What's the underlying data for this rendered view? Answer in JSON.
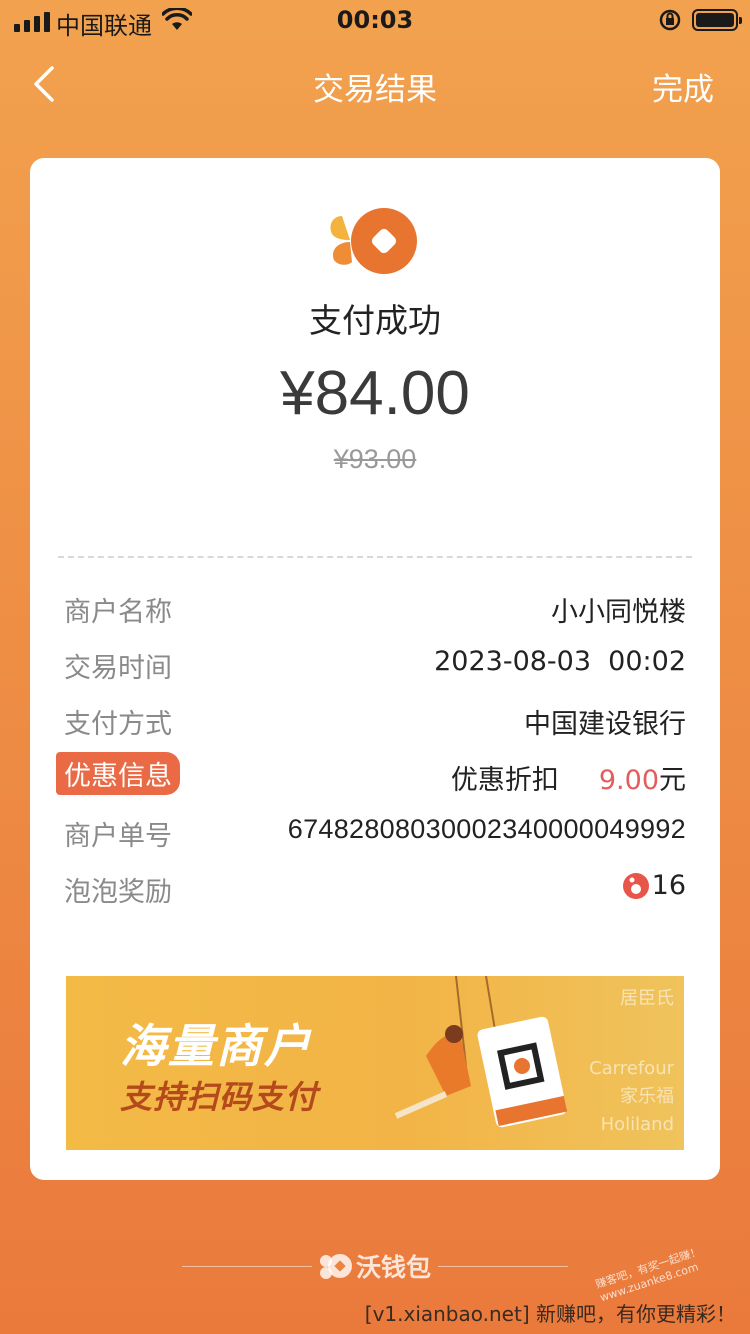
{
  "status_bar": {
    "carrier": "中国联通",
    "time": "00:03"
  },
  "nav": {
    "title": "交易结果",
    "done_label": "完成"
  },
  "result": {
    "status": "支付成功",
    "amount": "¥84.00",
    "original_amount": "¥93.00"
  },
  "details": {
    "merchant_label": "商户名称",
    "merchant_value": "小小同悦楼",
    "time_label": "交易时间",
    "time_value": "2023-08-03  00:02",
    "method_label": "支付方式",
    "method_value": "中国建设银行",
    "promo_label": "优惠信息",
    "promo_type": "优惠折扣",
    "promo_amount": "9.00",
    "promo_unit": "元",
    "order_label": "商户单号",
    "order_value": "67482808030002340000049992",
    "reward_label": "泡泡奖励",
    "reward_value": "16"
  },
  "banner": {
    "headline": "海量商户",
    "sub": "支持扫码支付",
    "brands": [
      "居臣氏",
      "Carrefour",
      "家乐福",
      "Holiland"
    ]
  },
  "footer": {
    "brand": "沃钱包",
    "watermark": "[v1.xianbao.net] 新赚吧，有你更精彩！",
    "diag_watermark": "赚客吧，有奖一起赚！ www.zuanke8.com"
  },
  "colors": {
    "accent": "#e96a44",
    "discount_red": "#e45c5c",
    "logo_orange": "#e8752f",
    "logo_yellow": "#f3b33e"
  }
}
